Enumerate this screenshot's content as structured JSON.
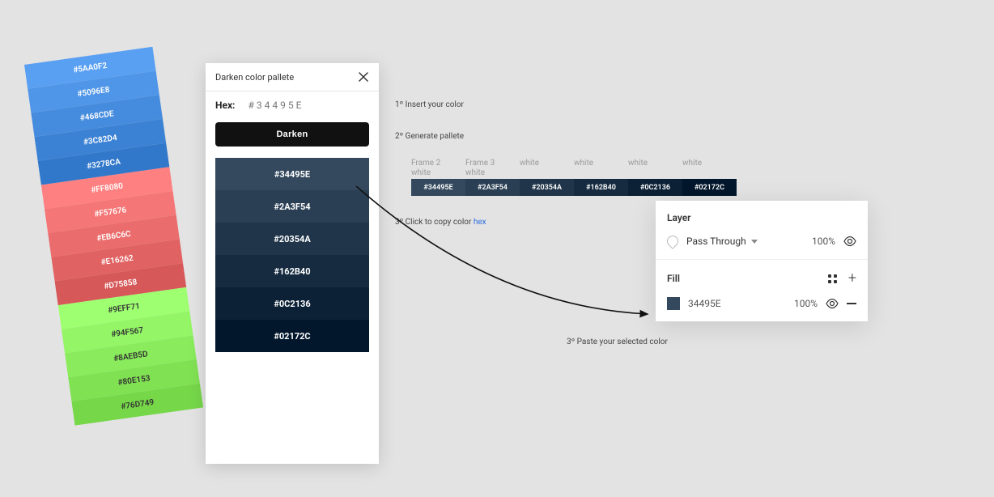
{
  "tilted_swatches": [
    {
      "hex": "#5AA0F2",
      "bg": "#5AA0F2",
      "dark": false
    },
    {
      "hex": "#5096E8",
      "bg": "#5096E8",
      "dark": false
    },
    {
      "hex": "#468CDE",
      "bg": "#468CDE",
      "dark": false
    },
    {
      "hex": "#3C82D4",
      "bg": "#3C82D4",
      "dark": false
    },
    {
      "hex": "#3278CA",
      "bg": "#3278CA",
      "dark": false
    },
    {
      "hex": "#FF8080",
      "bg": "#FF8080",
      "dark": false
    },
    {
      "hex": "#F57676",
      "bg": "#F57676",
      "dark": false
    },
    {
      "hex": "#EB6C6C",
      "bg": "#EB6C6C",
      "dark": false
    },
    {
      "hex": "#E16262",
      "bg": "#E16262",
      "dark": false
    },
    {
      "hex": "#D75858",
      "bg": "#D75858",
      "dark": false
    },
    {
      "hex": "#9EFF71",
      "bg": "#9EFF71",
      "dark": true
    },
    {
      "hex": "#94F567",
      "bg": "#94F567",
      "dark": true
    },
    {
      "hex": "#8AEB5D",
      "bg": "#8AEB5D",
      "dark": true
    },
    {
      "hex": "#80E153",
      "bg": "#80E153",
      "dark": true
    },
    {
      "hex": "#76D749",
      "bg": "#76D749",
      "dark": true
    }
  ],
  "dialog": {
    "title": "Darken color pallete",
    "hex_label": "Hex:",
    "hex_value": "#34495E",
    "button": "Darken",
    "results": [
      {
        "hex": "#34495E"
      },
      {
        "hex": "#2A3F54"
      },
      {
        "hex": "#20354A"
      },
      {
        "hex": "#162B40"
      },
      {
        "hex": "#0C2136"
      },
      {
        "hex": "#02172C"
      }
    ]
  },
  "captions": {
    "step1": "1º Insert your color",
    "step2": "2º Generate pallete",
    "step3_pre": "3º Click to copy color ",
    "step3_link": "hex",
    "step4": "3º Paste your selected color"
  },
  "frame_labels": [
    {
      "top": "Frame 2",
      "bottom": "white"
    },
    {
      "top": "Frame 3",
      "bottom": "white"
    },
    {
      "top": "",
      "bottom": "white"
    },
    {
      "top": "",
      "bottom": "white"
    },
    {
      "top": "",
      "bottom": "white"
    },
    {
      "top": "",
      "bottom": "white"
    }
  ],
  "chips": [
    {
      "hex": "#34495E"
    },
    {
      "hex": "#2A3F54"
    },
    {
      "hex": "#20354A"
    },
    {
      "hex": "#162B40"
    },
    {
      "hex": "#0C2136"
    },
    {
      "hex": "#02172C"
    }
  ],
  "panel": {
    "layer_title": "Layer",
    "blend_mode": "Pass Through",
    "layer_opacity": "100%",
    "fill_title": "Fill",
    "fill_hex": "34495E",
    "fill_color": "#34495E",
    "fill_opacity": "100%"
  }
}
